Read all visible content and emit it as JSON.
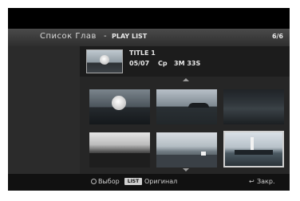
{
  "header": {
    "title": "Список Глав",
    "separator": "-",
    "subtitle": "PLAY LIST",
    "page_count": "6/6"
  },
  "info": {
    "title": "TITLE 1",
    "date": "05/07",
    "mode": "Cp",
    "duration": "3M 33S"
  },
  "thumbnails": [
    {
      "name": "chapter-1"
    },
    {
      "name": "chapter-2"
    },
    {
      "name": "chapter-3"
    },
    {
      "name": "chapter-4"
    },
    {
      "name": "chapter-5"
    },
    {
      "name": "chapter-6",
      "selected": true
    }
  ],
  "footer": {
    "select_label": "Выбор",
    "list_key": "LIST",
    "original_label": "Оригинал",
    "close_label": "Закр.",
    "return_icon": "return-icon"
  },
  "colors": {
    "panel": "#000000",
    "header": "#3a3a3a",
    "selection_border": "#d0d0d0",
    "text": "#e8e8e8"
  }
}
